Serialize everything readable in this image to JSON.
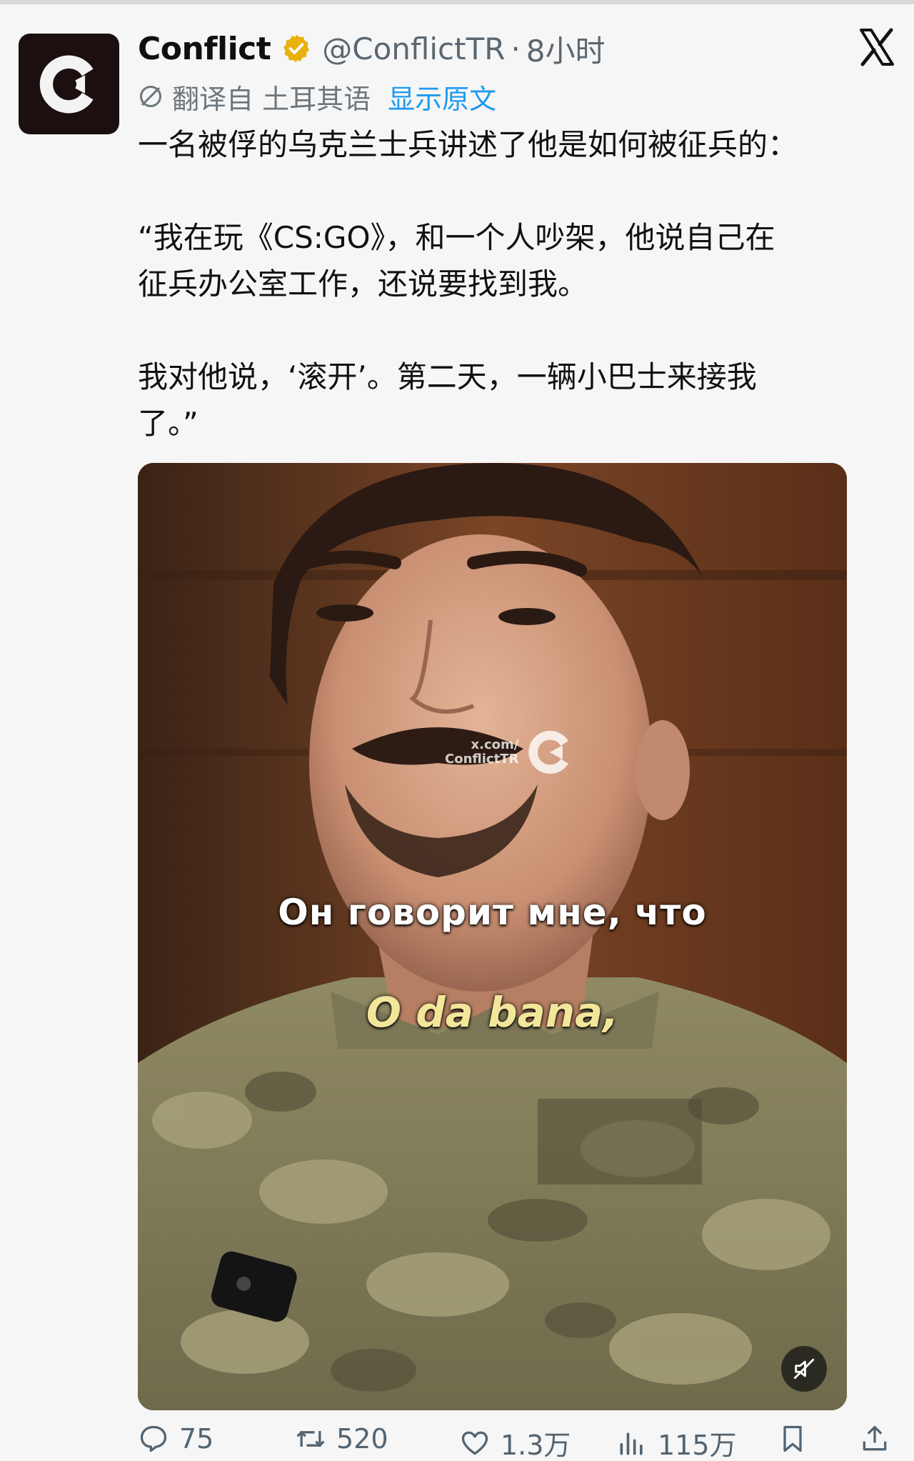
{
  "tweet": {
    "author_name": "Conflict",
    "handle": "@ConflictTR",
    "separator": "·",
    "time": "8小时",
    "translation": {
      "label": "翻译自 土耳其语",
      "show_original": "显示原文"
    },
    "text": {
      "line1": "一名被俘的乌克兰士兵讲述了他是如何被征兵的：",
      "para2_line1": "“我在玩《CS:GO》，和一个人吵架，他说自己在",
      "para2_line2": "征兵办公室工作，还说要找到我。",
      "para3_line1": "我对他说，‘滚开’。第二天，一辆小巴士来接我",
      "para3_line2": "了。”"
    },
    "media": {
      "watermark_line1": "x.com/",
      "watermark_line2": "ConflictTR",
      "subtitle_ru": "Он говорит мне, что",
      "subtitle_tr": "O da bana,"
    },
    "stats": {
      "replies": "75",
      "reposts": "520",
      "likes": "1.3万",
      "views": "115万"
    }
  },
  "icons": {
    "avatar": "conflict-logo",
    "verified": "verified-badge-icon",
    "close": "x-logo-icon",
    "translate": "globe-icon",
    "mute": "mute-icon",
    "reply": "reply-icon",
    "repost": "repost-icon",
    "like": "heart-icon",
    "views": "views-icon",
    "bookmark": "bookmark-icon",
    "share": "share-icon"
  },
  "colors": {
    "link": "#1d9bf0",
    "verified": "#e8b10d",
    "muted_text": "#536471"
  }
}
